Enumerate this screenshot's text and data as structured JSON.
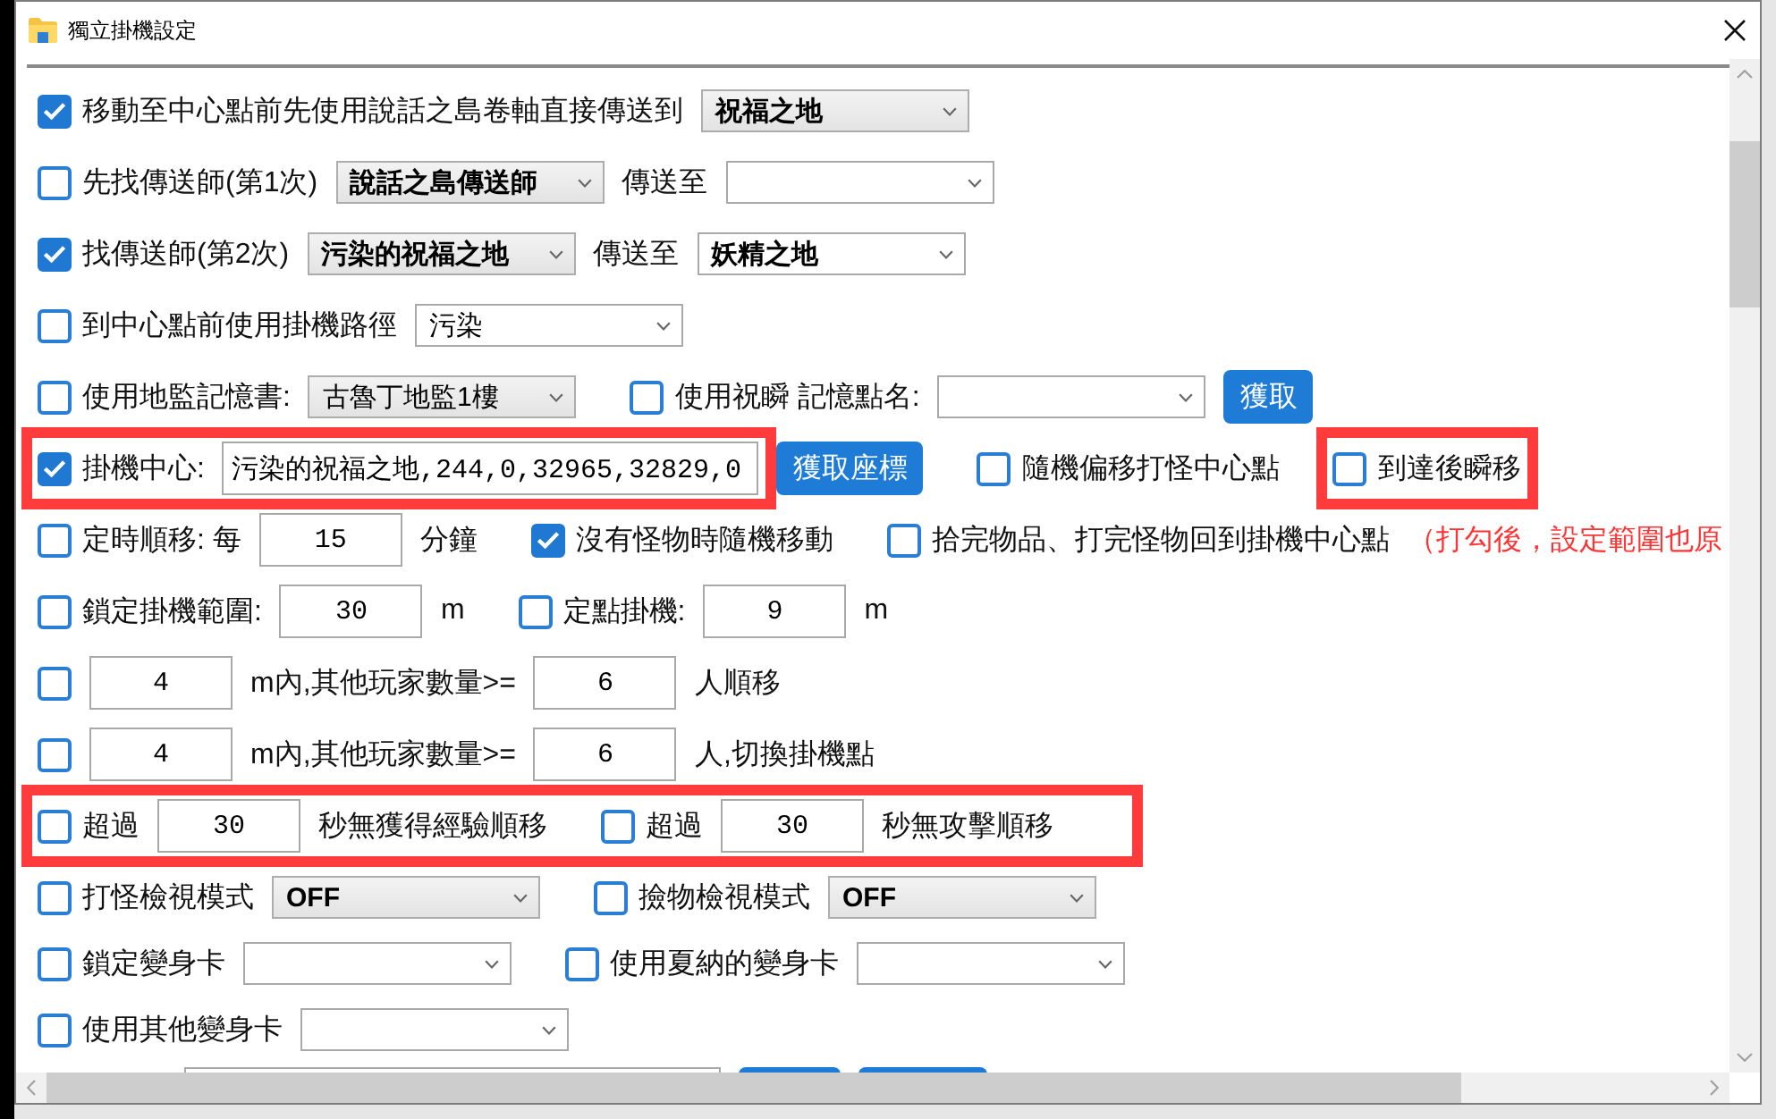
{
  "window": {
    "title": "獨立掛機設定"
  },
  "rows": [
    {
      "items": [
        {
          "kind": "checkbox",
          "checked": true,
          "label": "移動至中心點前先使用說話之島卷軸直接傳送到"
        },
        {
          "kind": "list_dropdown",
          "bold": true,
          "value": "祝福之地"
        }
      ]
    },
    {
      "items": [
        {
          "kind": "checkbox",
          "checked": false,
          "label": "先找傳送師(第1次)"
        },
        {
          "kind": "list_dropdown",
          "bold": true,
          "value": "說話之島傳送師"
        },
        {
          "kind": "text",
          "text": "傳送至"
        },
        {
          "kind": "combo_box"
        }
      ]
    },
    {
      "items": [
        {
          "kind": "checkbox",
          "checked": true,
          "label": "找傳送師(第2次)"
        },
        {
          "kind": "list_dropdown",
          "bold": true,
          "value": "污染的祝福之地"
        },
        {
          "kind": "text",
          "text": "傳送至"
        },
        {
          "kind": "combo_box",
          "bold": true,
          "value": "妖精之地"
        }
      ]
    },
    {
      "items": [
        {
          "kind": "checkbox",
          "checked": false,
          "label": "到中心點前使用掛機路徑"
        },
        {
          "kind": "combo_box",
          "bold": false,
          "value": "污染"
        }
      ]
    },
    {
      "items": [
        {
          "kind": "checkbox",
          "checked": false,
          "label": "使用地監記憶書:"
        },
        {
          "kind": "list_dropdown",
          "bold": false,
          "value": "古魯丁地監1樓"
        },
        {
          "kind": "checkbox",
          "checked": false,
          "label": "使用祝瞬 記憶點名:"
        },
        {
          "kind": "combo_box"
        },
        {
          "kind": "button",
          "label": "獲取"
        }
      ]
    },
    {
      "items": [
        {
          "kind": "group",
          "highlighted": true,
          "items": [
            {
              "kind": "checkbox",
              "checked": true,
              "label": "掛機中心:"
            },
            {
              "kind": "text_field",
              "value": "污染的祝福之地,244,0,32965,32829,0"
            }
          ]
        },
        {
          "kind": "button",
          "label": "獲取座標"
        },
        {
          "kind": "checkbox",
          "checked": false,
          "label": "隨機偏移打怪中心點"
        },
        {
          "kind": "group",
          "highlighted": true,
          "items": [
            {
              "kind": "checkbox",
              "checked": false,
              "label": "到達後瞬移"
            }
          ]
        }
      ]
    },
    {
      "items": [
        {
          "kind": "checkbox",
          "checked": false,
          "label": "定時順移: 每"
        },
        {
          "kind": "number_field",
          "value": "15"
        },
        {
          "kind": "text",
          "text": "分鐘"
        },
        {
          "kind": "checkbox",
          "checked": true,
          "label": "沒有怪物時隨機移動"
        },
        {
          "kind": "checkbox",
          "checked": false,
          "label": "拾完物品、打完怪物回到掛機中心點"
        },
        {
          "kind": "note",
          "text": "（打勾後，設定範圍也原"
        }
      ]
    },
    {
      "items": [
        {
          "kind": "checkbox",
          "checked": false,
          "label": "鎖定掛機範圍:"
        },
        {
          "kind": "number_field",
          "value": "30"
        },
        {
          "kind": "text",
          "text": "m"
        },
        {
          "kind": "checkbox",
          "checked": false,
          "label": "定點掛機:"
        },
        {
          "kind": "number_field",
          "value": "9"
        },
        {
          "kind": "text",
          "text": "m"
        }
      ]
    },
    {
      "items": [
        {
          "kind": "checkbox",
          "checked": false
        },
        {
          "kind": "number_field",
          "value": "4"
        },
        {
          "kind": "text",
          "text": "m內,其他玩家數量>="
        },
        {
          "kind": "number_field",
          "value": "6"
        },
        {
          "kind": "text",
          "text": "人順移"
        }
      ]
    },
    {
      "items": [
        {
          "kind": "checkbox",
          "checked": false
        },
        {
          "kind": "number_field",
          "value": "4"
        },
        {
          "kind": "text",
          "text": "m內,其他玩家數量>="
        },
        {
          "kind": "number_field",
          "value": "6"
        },
        {
          "kind": "text",
          "text": "人,切換掛機點"
        }
      ]
    },
    {
      "items": [
        {
          "kind": "group",
          "highlighted": true,
          "items": [
            {
              "kind": "checkbox",
              "checked": false,
              "label": "超過"
            },
            {
              "kind": "number_field",
              "value": "30"
            },
            {
              "kind": "text",
              "text": "秒無獲得經驗順移"
            },
            {
              "kind": "checkbox",
              "checked": false,
              "label": "超過"
            },
            {
              "kind": "number_field",
              "value": "30"
            },
            {
              "kind": "text",
              "text": "秒無攻擊順移"
            }
          ]
        }
      ]
    },
    {
      "items": [
        {
          "kind": "checkbox",
          "checked": false,
          "label": "打怪檢視模式"
        },
        {
          "kind": "list_dropdown",
          "bold": true,
          "value": "OFF"
        },
        {
          "kind": "checkbox",
          "checked": false,
          "label": "撿物檢視模式"
        },
        {
          "kind": "list_dropdown",
          "bold": true,
          "value": "OFF"
        }
      ]
    },
    {
      "items": [
        {
          "kind": "checkbox",
          "checked": false,
          "label": "鎖定變身卡"
        },
        {
          "kind": "combo_box"
        },
        {
          "kind": "checkbox",
          "checked": false,
          "label": "使用夏納的變身卡"
        },
        {
          "kind": "combo_box"
        }
      ]
    },
    {
      "items": [
        {
          "kind": "checkbox",
          "checked": false,
          "label": "使用其他變身卡"
        },
        {
          "kind": "combo_box"
        }
      ]
    },
    {
      "items": [
        {
          "kind": "text_field"
        },
        {
          "kind": "button"
        },
        {
          "kind": "button"
        }
      ]
    }
  ]
}
